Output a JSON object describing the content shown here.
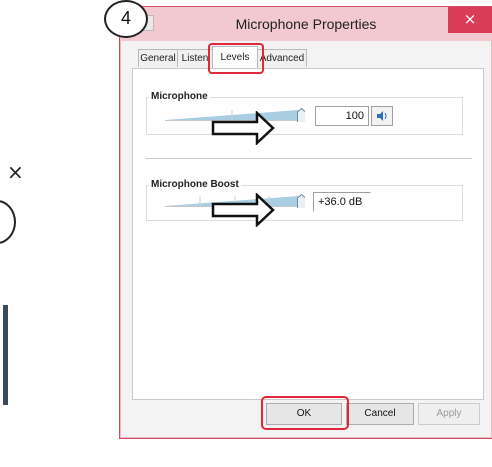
{
  "step_number": "4",
  "window": {
    "title": "Microphone Properties",
    "close_glyph": "×"
  },
  "tabs": [
    {
      "label": "General"
    },
    {
      "label": "Listen"
    },
    {
      "label": "Levels"
    },
    {
      "label": "Advanced"
    }
  ],
  "levels": {
    "microphone": {
      "label": "Microphone",
      "value": "100",
      "level": 100
    },
    "boost": {
      "label": "Microphone Boost",
      "value": "+36.0 dB"
    }
  },
  "buttons": {
    "ok": "OK",
    "cancel": "Cancel",
    "apply": "Apply"
  },
  "background": {
    "close_glyph": "×"
  },
  "colors": {
    "highlight": "#e0283c",
    "title_bar": "#f2c9d0",
    "close_button": "#d83c56"
  }
}
